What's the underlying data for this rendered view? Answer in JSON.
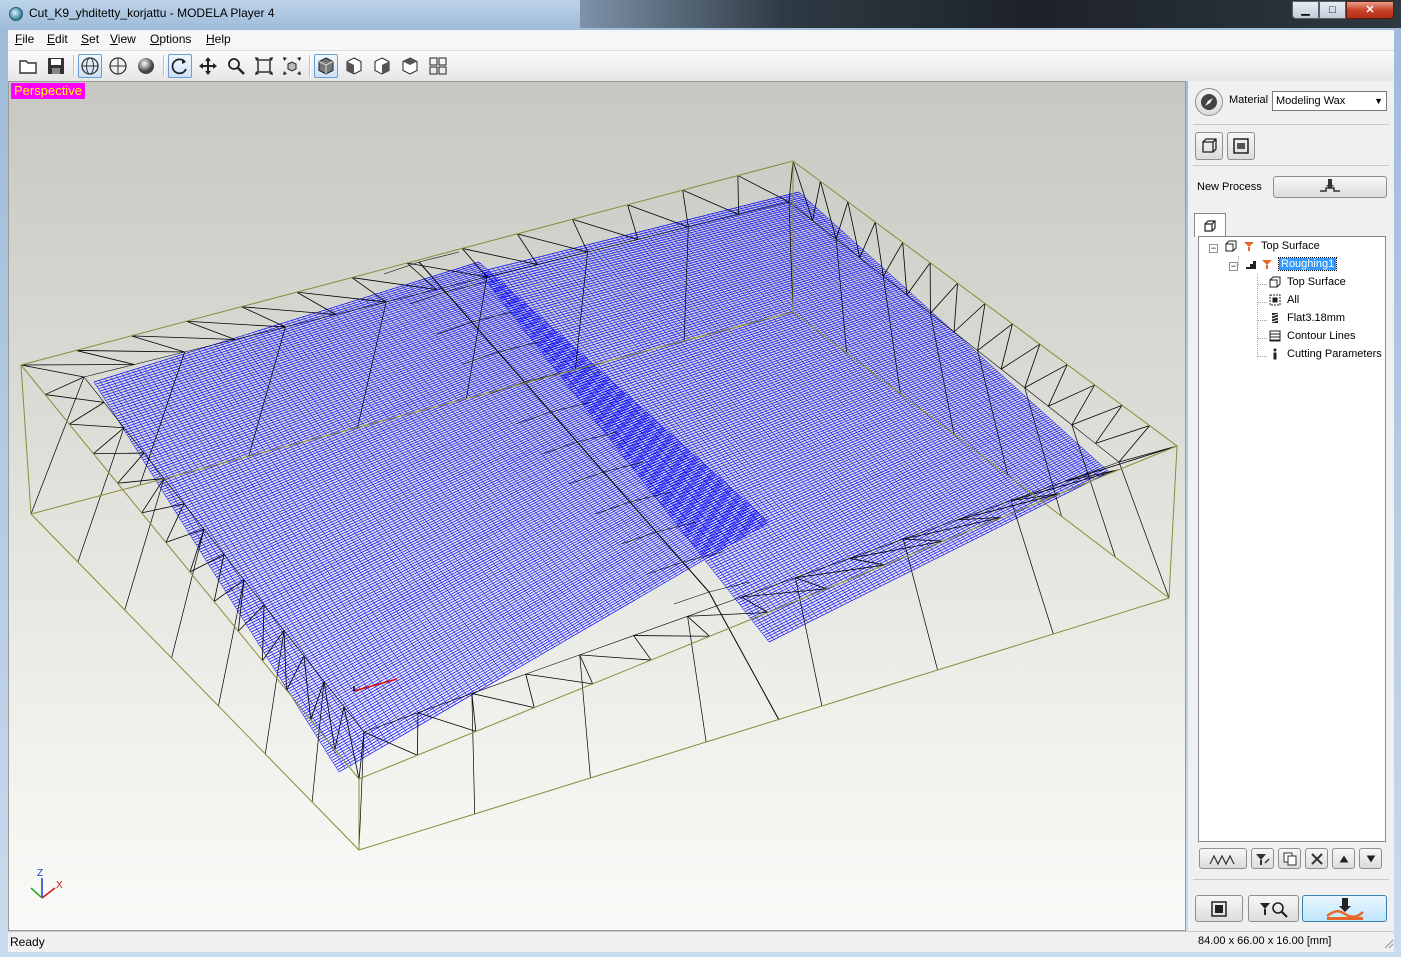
{
  "window": {
    "title": "Cut_K9_yhditetty_korjattu - MODELA Player 4",
    "minimize": "▁",
    "maximize": "□",
    "close": "✕"
  },
  "menu": {
    "items": [
      {
        "accel": "F",
        "rest": "ile"
      },
      {
        "accel": "E",
        "rest": "dit"
      },
      {
        "accel": "S",
        "rest": "et"
      },
      {
        "accel": "V",
        "rest": "iew"
      },
      {
        "accel": "O",
        "rest": "ptions"
      },
      {
        "accel": "H",
        "rest": "elp"
      }
    ]
  },
  "toolbar": {
    "icons": [
      "open-folder-icon",
      "save-icon",
      "wireframe-icon",
      "silhouette-icon",
      "shaded-icon",
      "rotate-icon",
      "pan-icon",
      "zoom-icon",
      "fit-icon",
      "fit-all-icon",
      "view-iso-icon",
      "view-front-icon",
      "view-right-icon",
      "view-top-icon",
      "view-multi-icon"
    ]
  },
  "viewport": {
    "view_label": "Perspective",
    "axis_z": "Z",
    "axis_x": "X",
    "colors": {
      "toolpath": "#0000ff",
      "mesh": "#000000",
      "bounds": "#8b8b3a",
      "label_bg": "#ff00ff",
      "label_fg": "#ffff00"
    }
  },
  "panel": {
    "material_label": "Material",
    "material_value": "Modeling Wax",
    "new_process_label": "New Process",
    "tree": [
      {
        "label": "Top Surface",
        "icon": "surface-icon"
      },
      {
        "label": "Roughing1",
        "icon": "roughing-icon",
        "selected": true
      },
      {
        "label": "Top Surface",
        "icon": "surface-icon"
      },
      {
        "label": "All",
        "icon": "area-all-icon"
      },
      {
        "label": "Flat3.18mm",
        "icon": "tool-icon"
      },
      {
        "label": "Contour Lines",
        "icon": "contour-icon"
      },
      {
        "label": "Cutting Parameters",
        "icon": "info-icon"
      }
    ]
  },
  "status": {
    "left": "Ready",
    "right": "84.00 x 66.00 x 16.00 [mm]"
  }
}
